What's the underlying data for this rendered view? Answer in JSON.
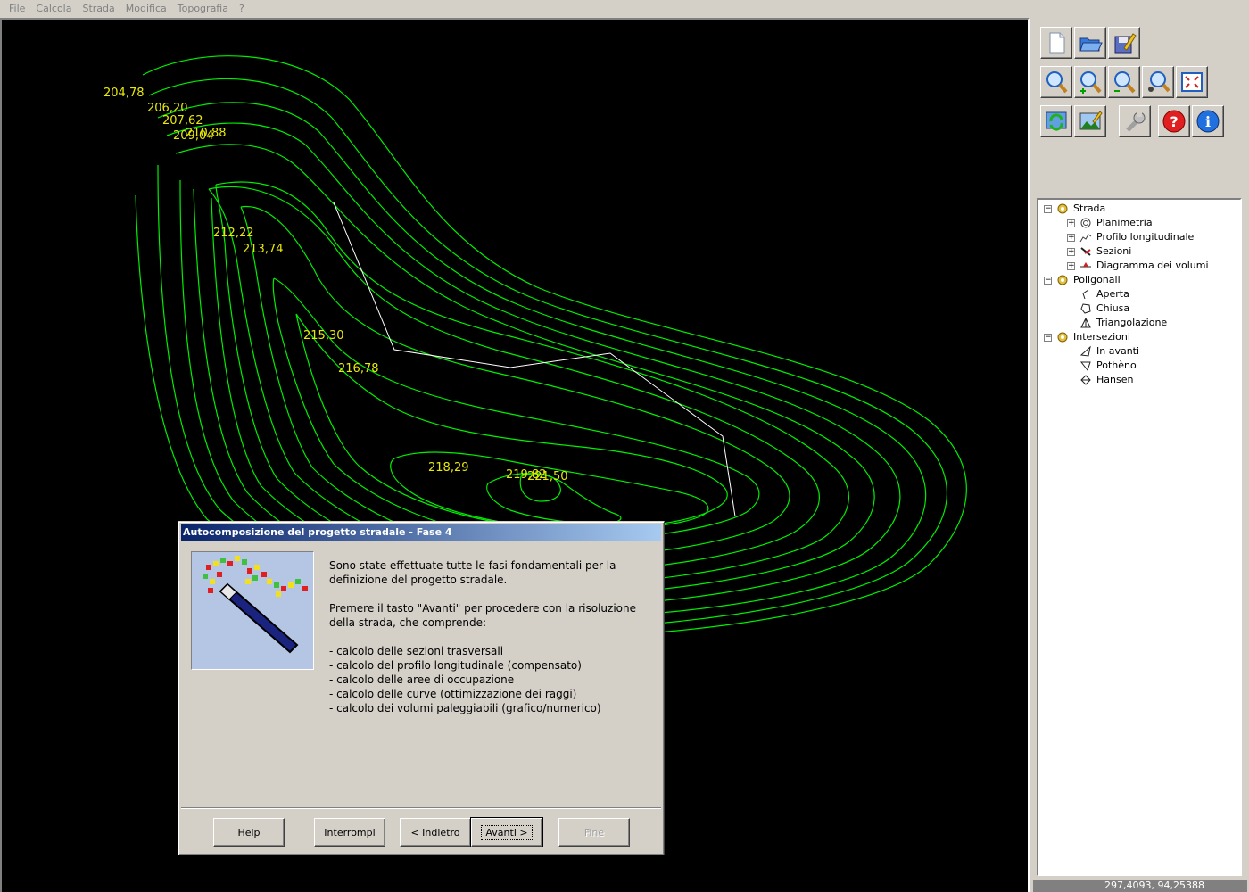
{
  "menu": [
    "File",
    "Calcola",
    "Strada",
    "Modifica",
    "Topografia",
    "?"
  ],
  "elevations": [
    "204,78",
    "206,20",
    "207,62",
    "209,04",
    "210,88",
    "212,22",
    "213,74",
    "215,30",
    "216,78",
    "218,29",
    "219,82",
    "221,50"
  ],
  "colors": {
    "contour": "#00ee00",
    "labels": "#e8e80a",
    "alignment": "#ffffff",
    "canvas": "#000000"
  },
  "toolbar": [
    "new-file-icon",
    "open-folder-icon",
    "save-edit-icon",
    "zoom-window-icon",
    "zoom-in-icon",
    "zoom-out-icon",
    "zoom-realtime-icon",
    "zoom-extents-icon",
    "refresh-icon",
    "image-edit-icon",
    "wrench-icon",
    "help-icon",
    "info-icon"
  ],
  "tree": {
    "strada": {
      "label": "Strada",
      "children": [
        "Planimetria",
        "Profilo longitudinale",
        "Sezioni",
        "Diagramma dei volumi"
      ]
    },
    "poligonali": {
      "label": "Poligonali",
      "children": [
        "Aperta",
        "Chiusa",
        "Triangolazione"
      ]
    },
    "intersezioni": {
      "label": "Intersezioni",
      "children": [
        "In avanti",
        "Pothèno",
        "Hansen"
      ]
    }
  },
  "status": {
    "coords": "297,4093,  94,25388"
  },
  "dialog": {
    "title": "Autocomposizione del progetto stradale - Fase 4",
    "para1": "Sono state effettuate tutte le fasi fondamentali per la definizione del progetto stradale.",
    "para2": "Premere il tasto \"Avanti\" per procedere con la risoluzione della strada, che comprende:",
    "items": [
      "- calcolo delle sezioni trasversali",
      "- calcolo del profilo longitudinale (compensato)",
      "- calcolo delle aree di occupazione",
      "- calcolo delle curve (ottimizzazione dei raggi)",
      "- calcolo dei volumi paleggiabili (grafico/numerico)"
    ],
    "buttons": {
      "help": "Help",
      "interrompi": "Interrompi",
      "indietro": "< Indietro",
      "avanti": "Avanti >",
      "fine": "Fine"
    }
  }
}
